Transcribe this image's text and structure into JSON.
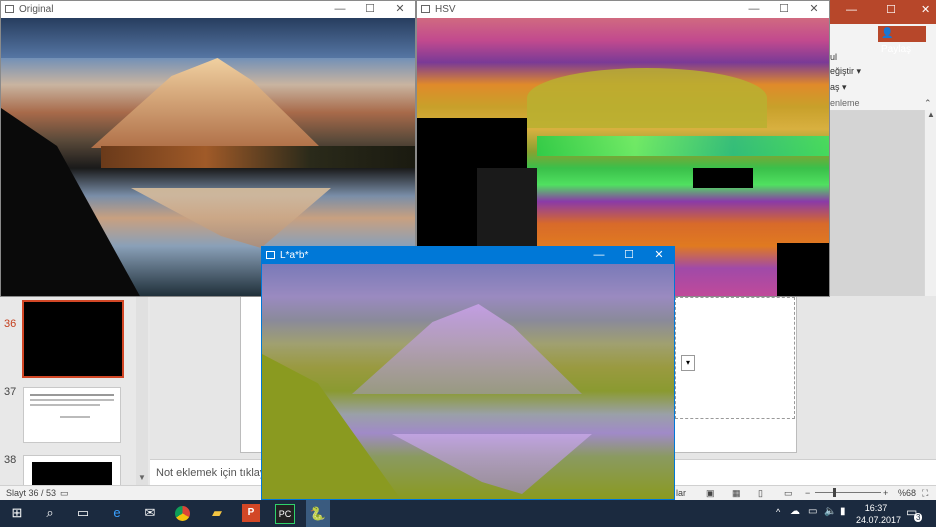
{
  "powerpoint": {
    "share_label": "Paylaş",
    "ribbon_items": [
      "ul",
      "eğiştir",
      "aş",
      "enleme"
    ],
    "slides": [
      {
        "number": "36"
      },
      {
        "number": "37"
      },
      {
        "number": "38"
      }
    ],
    "notes_placeholder": "Not eklemek için tıklayın",
    "status_slide": "Slayt 36 / 53",
    "status_notes": "lar",
    "zoom": "%68",
    "zoom_minus": "−",
    "zoom_plus": "+"
  },
  "windows": {
    "original": {
      "title": "Original"
    },
    "hsv": {
      "title": "HSV"
    },
    "lab": {
      "title": "L*a*b*"
    }
  },
  "window_buttons": {
    "minimize": "—",
    "maximize": "☐",
    "close": "✕"
  },
  "taskbar": {
    "time": "16:37",
    "date": "24.07.2017",
    "notification_count": "3",
    "apps": [
      "windows-start",
      "search",
      "task-view",
      "edge",
      "mail",
      "chrome",
      "file-explorer",
      "powerpoint",
      "pycharm",
      "python"
    ]
  },
  "colors": {
    "ppt_accent": "#b7472a",
    "active_title": "#0078d7",
    "taskbar": "#1b2a3f"
  }
}
